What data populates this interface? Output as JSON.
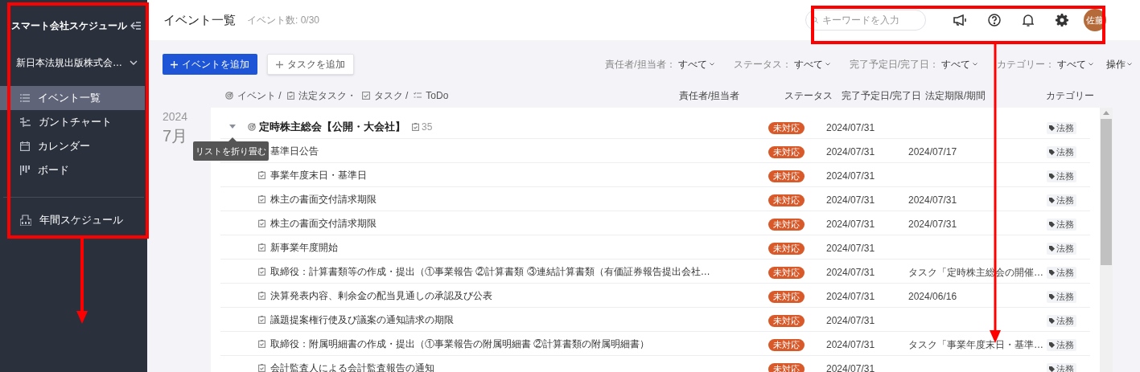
{
  "sidebar": {
    "title": "スマート会社スケジュール",
    "company": "新日本法規出版株式会…",
    "items": [
      {
        "label": "イベント一覧",
        "selected": true
      },
      {
        "label": "ガントチャート",
        "selected": false
      },
      {
        "label": "カレンダー",
        "selected": false
      },
      {
        "label": "ボード",
        "selected": false
      }
    ],
    "footer_item": {
      "label": "年間スケジュール",
      "selected": false
    }
  },
  "header": {
    "title": "イベント一覧",
    "count": "イベント数: 0/30",
    "search": {
      "placeholder": "キーワードを入力"
    },
    "avatar": "佐藤"
  },
  "toolbar": {
    "buttons": [
      {
        "label": "イベントを追加",
        "kind": "primary"
      },
      {
        "label": "タスクを追加",
        "kind": "secondary"
      }
    ],
    "filters": [
      {
        "label": "責任者/担当者：",
        "value": "すべて"
      },
      {
        "label": "ステータス：",
        "value": "すべて"
      },
      {
        "label": "完了予定日/完了日：",
        "value": "すべて"
      },
      {
        "label": "カテゴリー：",
        "value": "すべて"
      }
    ],
    "menu": "操作"
  },
  "legend": [
    {
      "label": "イベント /",
      "kind": "event"
    },
    {
      "label": "法定タスク・",
      "kind": "legal"
    },
    {
      "label": "タスク /",
      "kind": "task"
    },
    {
      "label": "ToDo",
      "kind": "todo"
    }
  ],
  "columns": [
    "責任者/担当者",
    "ステータス",
    "完了予定日/完了日",
    "法定期限/期間",
    "カテゴリー"
  ],
  "period": {
    "year": "2024",
    "month": "7月"
  },
  "group": {
    "title": "定時株主総会【公開・大会社】",
    "count": "35",
    "expanded": true,
    "status": "未対応",
    "due": "2024/07/31",
    "category": "法務",
    "tooltip": "リストを折り畳む",
    "rows": [
      {
        "title": "基準日公告",
        "status": "未対応",
        "due": "2024/07/31",
        "legal": "2024/07/17",
        "category": "法務"
      },
      {
        "title": "事業年度末日・基準日",
        "status": "未対応",
        "due": "2024/07/31",
        "category": "法務"
      },
      {
        "title": "株主の書面交付請求期限",
        "status": "未対応",
        "due": "2024/07/31",
        "legal": "2024/07/31",
        "category": "法務"
      },
      {
        "title": "株主の書面交付請求期限",
        "status": "未対応",
        "due": "2024/07/31",
        "legal": "2024/07/31",
        "category": "法務"
      },
      {
        "title": "新事業年度開始",
        "status": "未対応",
        "due": "2024/07/31",
        "category": "法務"
      },
      {
        "title": "取締役：計算書類等の作成・提出（①事業報告 ②計算書類 ③連結計算書類（有価証券報告提出会社…",
        "status": "未対応",
        "due": "2024/07/31",
        "legal": "タスク「定時株主総会の開催…",
        "category": "法務"
      },
      {
        "title": "決算発表内容、剰余金の配当見通しの承認及び公表",
        "status": "未対応",
        "due": "2024/07/31",
        "legal": "2024/06/16",
        "category": "法務"
      },
      {
        "title": "議題提案権行使及び議案の通知請求の期限",
        "status": "未対応",
        "due": "2024/07/31",
        "category": "法務"
      },
      {
        "title": "取締役：附属明細書の作成・提出（①事業報告の附属明細書 ②計算書類の附属明細書）",
        "status": "未対応",
        "due": "2024/07/31",
        "legal": "タスク「事業年度末日・基準…",
        "category": "法務"
      },
      {
        "title": "会計監査人による会計監査報告の通知",
        "status": "未対応",
        "due": "2024/07/31",
        "category": "法務"
      }
    ]
  }
}
